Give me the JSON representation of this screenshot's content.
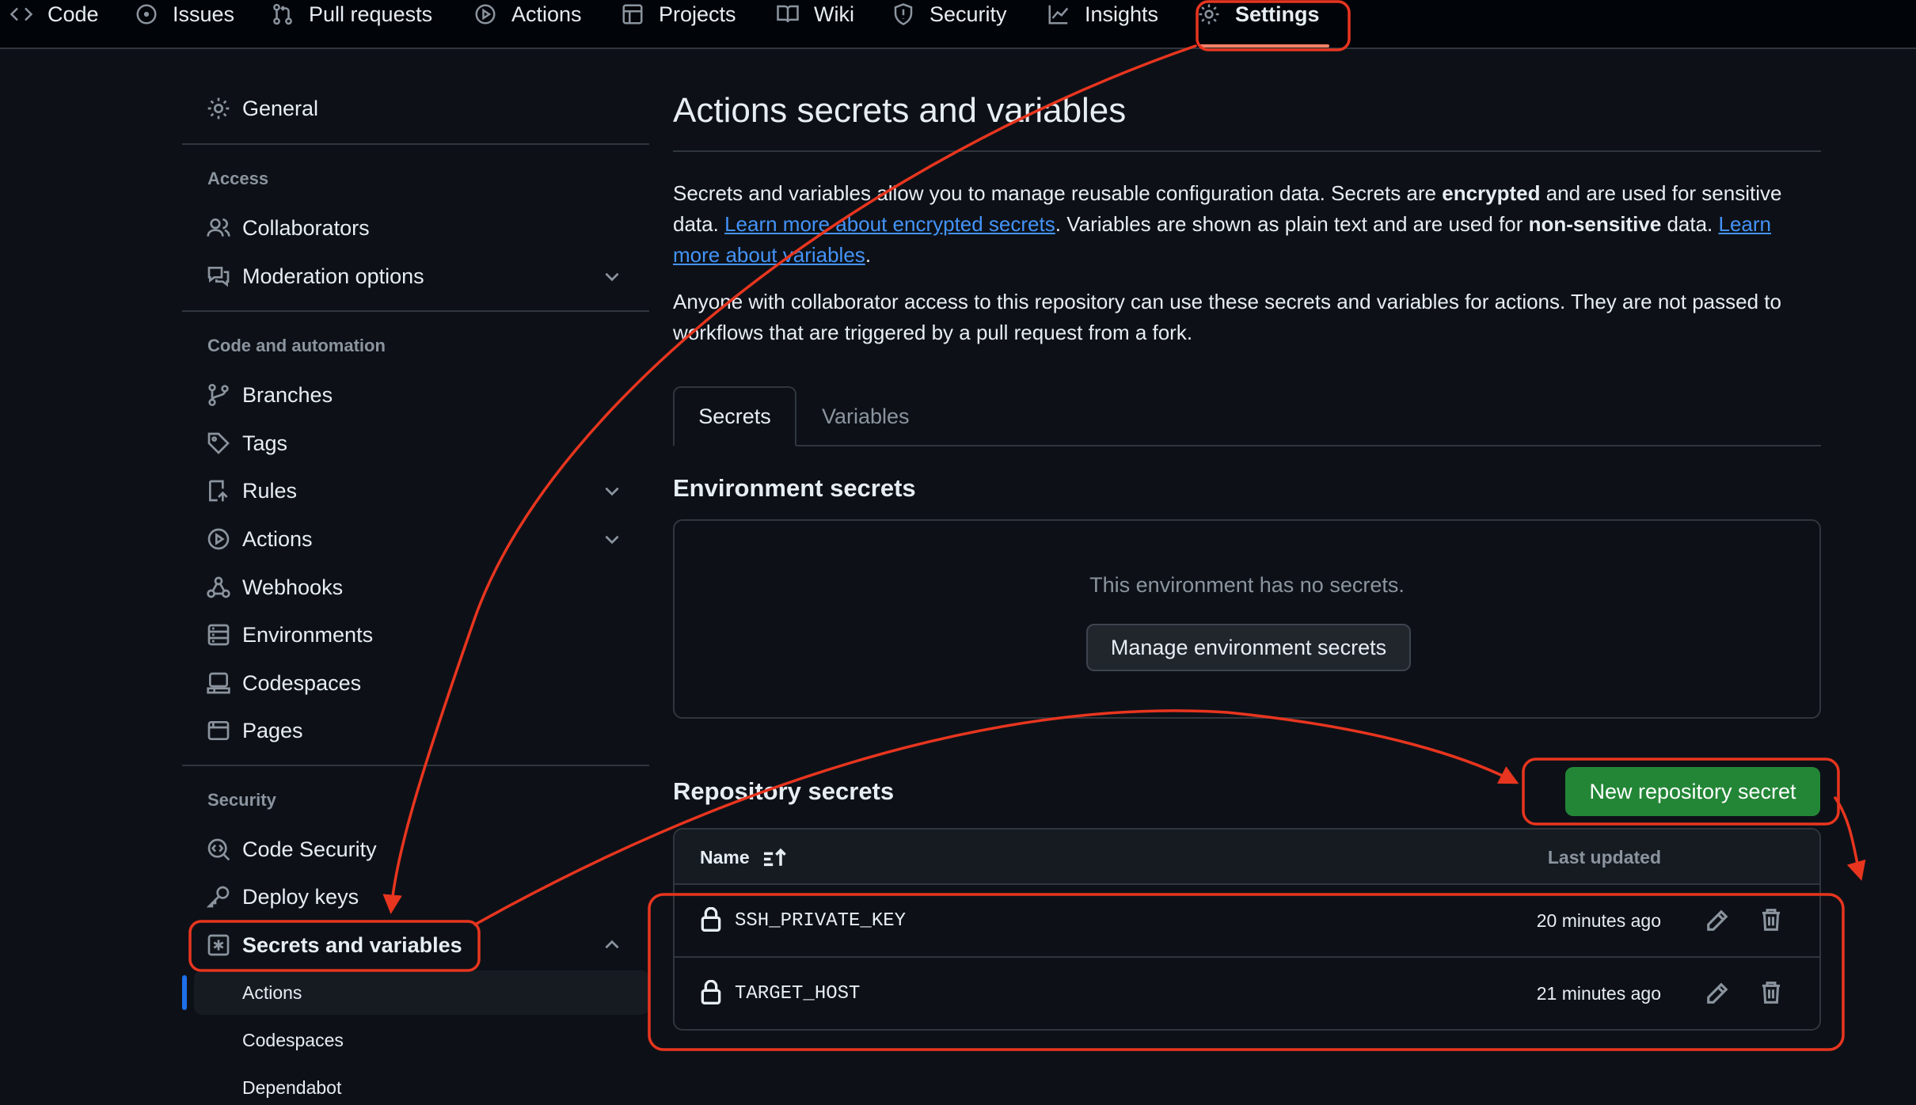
{
  "repo_nav": {
    "tabs": [
      {
        "label": "Code",
        "icon": "code-icon"
      },
      {
        "label": "Issues",
        "icon": "issue-icon"
      },
      {
        "label": "Pull requests",
        "icon": "pull-request-icon"
      },
      {
        "label": "Actions",
        "icon": "play-icon"
      },
      {
        "label": "Projects",
        "icon": "table-icon"
      },
      {
        "label": "Wiki",
        "icon": "book-icon"
      },
      {
        "label": "Security",
        "icon": "shield-icon"
      },
      {
        "label": "Insights",
        "icon": "graph-icon"
      },
      {
        "label": "Settings",
        "icon": "gear-icon",
        "active": true
      }
    ]
  },
  "sidebar": {
    "general": "General",
    "groups": {
      "access": "Access",
      "code_automation": "Code and automation",
      "security": "Security"
    },
    "access_items": [
      "Collaborators",
      "Moderation options"
    ],
    "code_items": [
      "Branches",
      "Tags",
      "Rules",
      "Actions",
      "Webhooks",
      "Environments",
      "Codespaces",
      "Pages"
    ],
    "security_items": [
      "Code Security",
      "Deploy keys",
      "Secrets and variables"
    ],
    "sub_items": [
      "Actions",
      "Codespaces",
      "Dependabot"
    ]
  },
  "main": {
    "title": "Actions secrets and variables",
    "intro_1": "Secrets and variables allow you to manage reusable configuration data. Secrets are ",
    "intro_bold_1": "encrypted",
    "intro_2": " and are used for sensitive data. ",
    "intro_link_1": "Learn more about encrypted secrets",
    "intro_3": ". Variables are shown as plain text and are used for ",
    "intro_bold_2": "non-sensitive",
    "intro_4": " data. ",
    "intro_link_2": "Learn more about variables",
    "intro_5": ".",
    "access_note": "Anyone with collaborator access to this repository can use these secrets and variables for actions. They are not passed to workflows that are triggered by a pull request from a fork.",
    "tabs": {
      "secrets": "Secrets",
      "variables": "Variables"
    },
    "env_heading": "Environment secrets",
    "env_empty": "This environment has no secrets.",
    "env_button": "Manage environment secrets",
    "repo_heading": "Repository secrets",
    "new_secret_button": "New repository secret",
    "table": {
      "col_name": "Name",
      "col_updated": "Last updated",
      "rows": [
        {
          "name": "SSH_PRIVATE_KEY",
          "updated": "20 minutes ago"
        },
        {
          "name": "TARGET_HOST",
          "updated": "21 minutes ago"
        }
      ]
    }
  },
  "colors": {
    "background": "#0d1117",
    "border": "#30363d",
    "link": "#4493f8",
    "primary_button": "#238636",
    "annotation": "#e8351f"
  }
}
